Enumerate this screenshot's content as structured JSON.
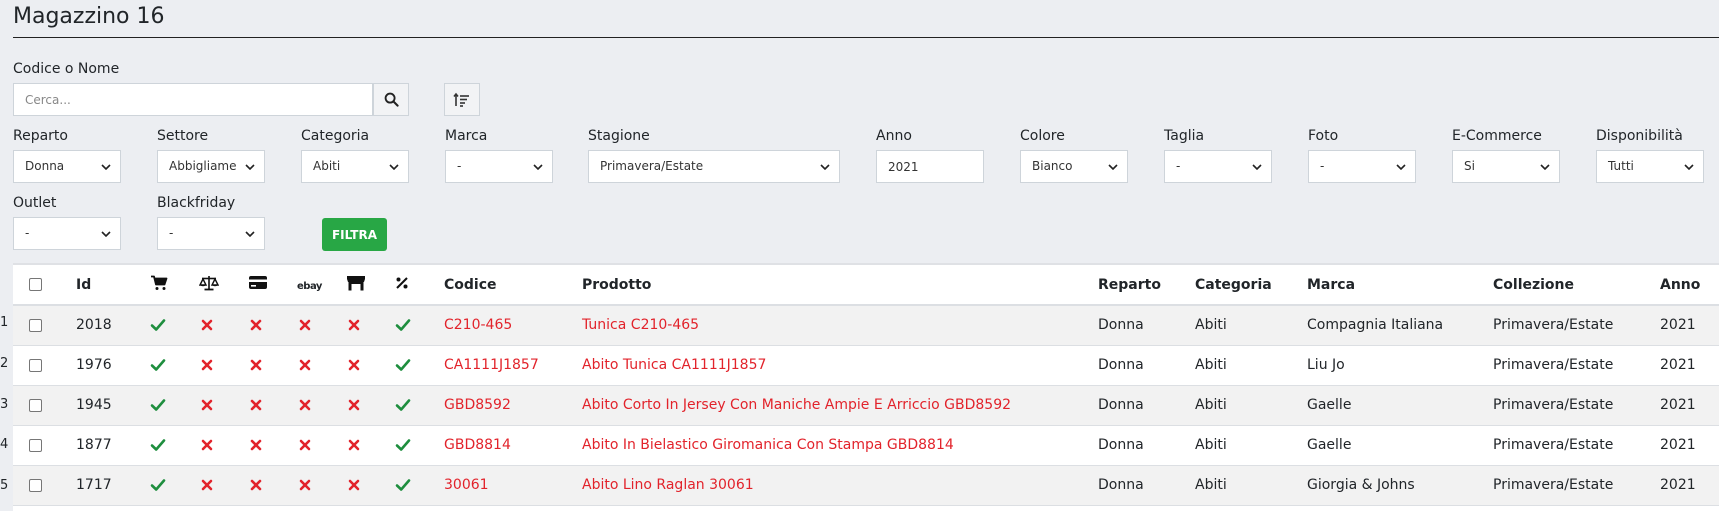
{
  "title": "Magazzino 16",
  "search": {
    "label": "Codice o Nome",
    "placeholder": "Cerca..."
  },
  "filters": {
    "reparto": {
      "label": "Reparto",
      "value": "Donna"
    },
    "settore": {
      "label": "Settore",
      "value": "Abbigliame"
    },
    "categoria": {
      "label": "Categoria",
      "value": "Abiti"
    },
    "marca": {
      "label": "Marca",
      "value": "-"
    },
    "stagione": {
      "label": "Stagione",
      "value": "Primavera/Estate"
    },
    "anno": {
      "label": "Anno",
      "value": "2021"
    },
    "colore": {
      "label": "Colore",
      "value": "Bianco"
    },
    "taglia": {
      "label": "Taglia",
      "value": "-"
    },
    "foto": {
      "label": "Foto",
      "value": "-"
    },
    "ecommerce": {
      "label": "E-Commerce",
      "value": "Si"
    },
    "disponibilita": {
      "label": "Disponibilità",
      "value": "Tutti"
    },
    "outlet": {
      "label": "Outlet",
      "value": "-"
    },
    "blackfriday": {
      "label": "Blackfriday",
      "value": "-"
    },
    "filter_button": "FILTRA"
  },
  "table": {
    "headers": {
      "id": "Id",
      "codice": "Codice",
      "prodotto": "Prodotto",
      "reparto": "Reparto",
      "categoria": "Categoria",
      "marca": "Marca",
      "collezione": "Collezione",
      "anno": "Anno",
      "ebay": "ebay"
    },
    "icon_columns": [
      "cart-icon",
      "scale-icon",
      "credit-card-icon",
      "ebay-icon",
      "store-icon",
      "percent-icon"
    ],
    "rows": [
      {
        "idx": "1",
        "id": "2018",
        "flags": [
          true,
          false,
          false,
          false,
          false,
          true
        ],
        "codice": "C210-465",
        "prodotto": "Tunica C210-465",
        "reparto": "Donna",
        "categoria": "Abiti",
        "marca": "Compagnia Italiana",
        "collezione": "Primavera/Estate",
        "anno": "2021"
      },
      {
        "idx": "2",
        "id": "1976",
        "flags": [
          true,
          false,
          false,
          false,
          false,
          true
        ],
        "codice": "CA1111J1857",
        "prodotto": "Abito Tunica CA1111J1857",
        "reparto": "Donna",
        "categoria": "Abiti",
        "marca": "Liu Jo",
        "collezione": "Primavera/Estate",
        "anno": "2021"
      },
      {
        "idx": "3",
        "id": "1945",
        "flags": [
          true,
          false,
          false,
          false,
          false,
          true
        ],
        "codice": "GBD8592",
        "prodotto": "Abito Corto In Jersey Con Maniche Ampie E Arriccio GBD8592",
        "reparto": "Donna",
        "categoria": "Abiti",
        "marca": "Gaelle",
        "collezione": "Primavera/Estate",
        "anno": "2021"
      },
      {
        "idx": "4",
        "id": "1877",
        "flags": [
          true,
          false,
          false,
          false,
          false,
          true
        ],
        "codice": "GBD8814",
        "prodotto": "Abito In Bielastico Giromanica Con Stampa GBD8814",
        "reparto": "Donna",
        "categoria": "Abiti",
        "marca": "Gaelle",
        "collezione": "Primavera/Estate",
        "anno": "2021"
      },
      {
        "idx": "5",
        "id": "1717",
        "flags": [
          true,
          false,
          false,
          false,
          false,
          true
        ],
        "codice": "30061",
        "prodotto": "Abito Lino Raglan 30061",
        "reparto": "Donna",
        "categoria": "Abiti",
        "marca": "Giorgia & Johns",
        "collezione": "Primavera/Estate",
        "anno": "2021"
      }
    ]
  },
  "colors": {
    "accent_red": "#e2232b",
    "ok_green": "#1e8e3e",
    "filter_green": "#28a745"
  }
}
